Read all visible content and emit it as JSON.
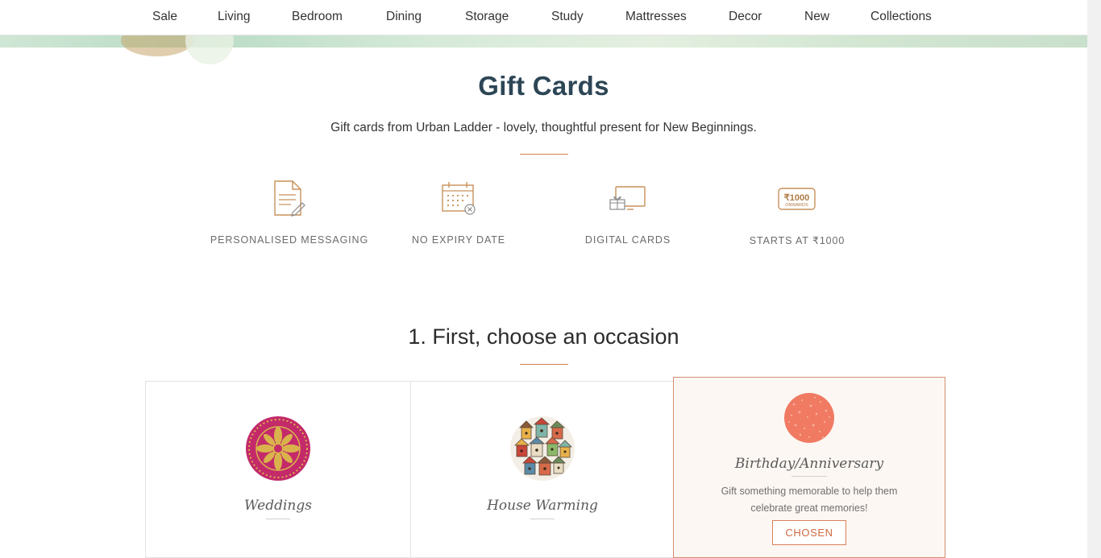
{
  "nav": {
    "items": [
      "Sale",
      "Living",
      "Bedroom",
      "Dining",
      "Storage",
      "Study",
      "Mattresses",
      "Decor",
      "New",
      "Collections"
    ]
  },
  "header": {
    "title": "Gift Cards",
    "subtitle": "Gift cards from Urban Ladder - lovely, thoughtful present for New Beginnings."
  },
  "features": [
    {
      "icon": "document-pen-icon",
      "label": "PERSONALISED MESSAGING"
    },
    {
      "icon": "calendar-icon",
      "label": "NO EXPIRY DATE"
    },
    {
      "icon": "monitor-gift-icon",
      "label": "DIGITAL CARDS"
    },
    {
      "icon": "rupee-1000-badge-icon",
      "label": "STARTS AT ₹1000",
      "badge_line1": "₹1000",
      "badge_line2": "ONWARDS"
    }
  ],
  "occasion": {
    "heading": "1. First, choose an occasion",
    "cards": [
      {
        "title": "Weddings",
        "selected": false
      },
      {
        "title": "House Warming",
        "selected": false
      },
      {
        "title": "Birthday/Anniversary",
        "selected": true,
        "description": "Gift something memorable to help them celebrate great memories!",
        "button_label": "CHOSEN"
      }
    ]
  },
  "colors": {
    "accent": "#d07f4f",
    "heading": "#2d4656",
    "selected_bg": "#fdf7f3"
  }
}
